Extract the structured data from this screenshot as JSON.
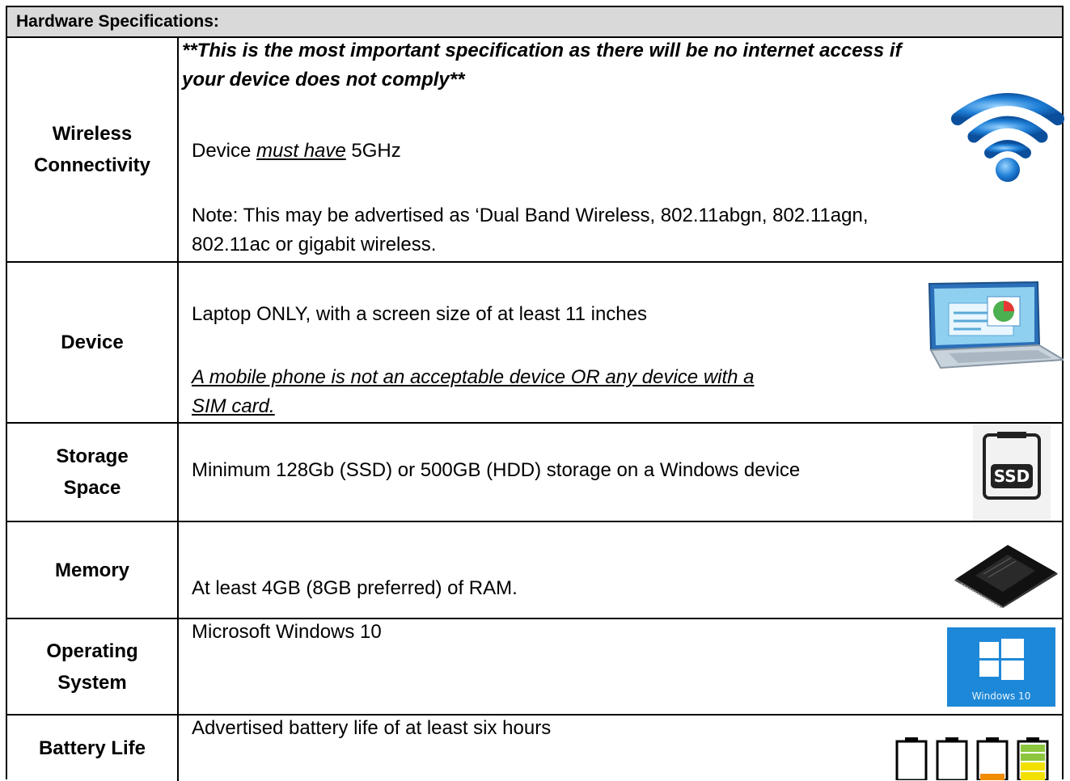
{
  "header": {
    "title": "Hardware Specifications:"
  },
  "rows": [
    {
      "label_lines": [
        "Wireless",
        "Connectivity"
      ],
      "important_line1": "**This is the most important specification as there will be no internet access if",
      "important_line2": "your device does not comply**",
      "must_prefix": "Device ",
      "must_emph": "must have",
      "must_suffix": " 5GHz",
      "note_line1": "Note: This may be advertised as ‘Dual Band Wireless, 802.11abgn, 802.11agn,",
      "note_line2": "802.11ac or gigabit wireless.",
      "icon": "wifi-icon"
    },
    {
      "label_lines": [
        "Device"
      ],
      "main": "Laptop ONLY, with a screen size of at least 11 inches",
      "warning_line1": "A mobile phone is not an acceptable device OR any device with a",
      "warning_line2": "SIM card.",
      "icon": "laptop-icon"
    },
    {
      "label_lines": [
        "Storage",
        "Space"
      ],
      "main": "Minimum 128Gb (SSD) or 500GB (HDD) storage on a Windows device",
      "icon": "ssd-icon",
      "icon_text": "SSD"
    },
    {
      "label_lines": [
        "Memory"
      ],
      "main": "At least 4GB (8GB preferred) of RAM.",
      "icon": "memory-chip-icon"
    },
    {
      "label_lines": [
        "Operating",
        "System"
      ],
      "main": "Microsoft Windows 10",
      "icon": "windows-logo-icon",
      "icon_text": "Windows 10"
    },
    {
      "label_lines": [
        "Battery Life"
      ],
      "main": "Advertised battery life of at least six hours",
      "icon": "battery-levels-icon"
    }
  ],
  "colors": {
    "header_bg": "#d9d9d9",
    "wifi_blue": "#1f7fd6",
    "windows_blue": "#1e88d8",
    "battery_orange": "#f08c00",
    "battery_yellow": "#f2e000",
    "battery_green": "#8cc63f"
  }
}
